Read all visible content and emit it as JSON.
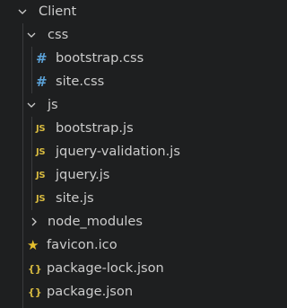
{
  "colors": {
    "background": "#1e1f20",
    "text": "#cccccc",
    "guide": "#3a3b3d",
    "css_icon": "#5ba2d8",
    "js_icon": "#d7ba40",
    "json_icon": "#d7ba40",
    "favicon_icon": "#e6c02e"
  },
  "tree": {
    "client": {
      "label": "Client",
      "expanded": true,
      "icon": "chevron-down-icon"
    },
    "css": {
      "label": "css",
      "expanded": true,
      "icon": "chevron-down-icon"
    },
    "css_files": [
      {
        "label": "bootstrap.css",
        "icon_glyph": "#",
        "icon": "css-file-icon"
      },
      {
        "label": "site.css",
        "icon_glyph": "#",
        "icon": "css-file-icon"
      }
    ],
    "js": {
      "label": "js",
      "expanded": true,
      "icon": "chevron-down-icon"
    },
    "js_files": [
      {
        "label": "bootstrap.js",
        "icon_glyph": "JS",
        "icon": "js-file-icon"
      },
      {
        "label": "jquery-validation.js",
        "icon_glyph": "JS",
        "icon": "js-file-icon"
      },
      {
        "label": "jquery.js",
        "icon_glyph": "JS",
        "icon": "js-file-icon"
      },
      {
        "label": "site.js",
        "icon_glyph": "JS",
        "icon": "js-file-icon"
      }
    ],
    "node_modules": {
      "label": "node_modules",
      "expanded": false,
      "icon": "chevron-right-icon"
    },
    "root_files": [
      {
        "label": "favicon.ico",
        "icon_glyph": "★",
        "icon": "star-icon"
      },
      {
        "label": "package-lock.json",
        "icon_glyph": "{}",
        "icon": "json-file-icon"
      },
      {
        "label": "package.json",
        "icon_glyph": "{}",
        "icon": "json-file-icon"
      }
    ]
  }
}
